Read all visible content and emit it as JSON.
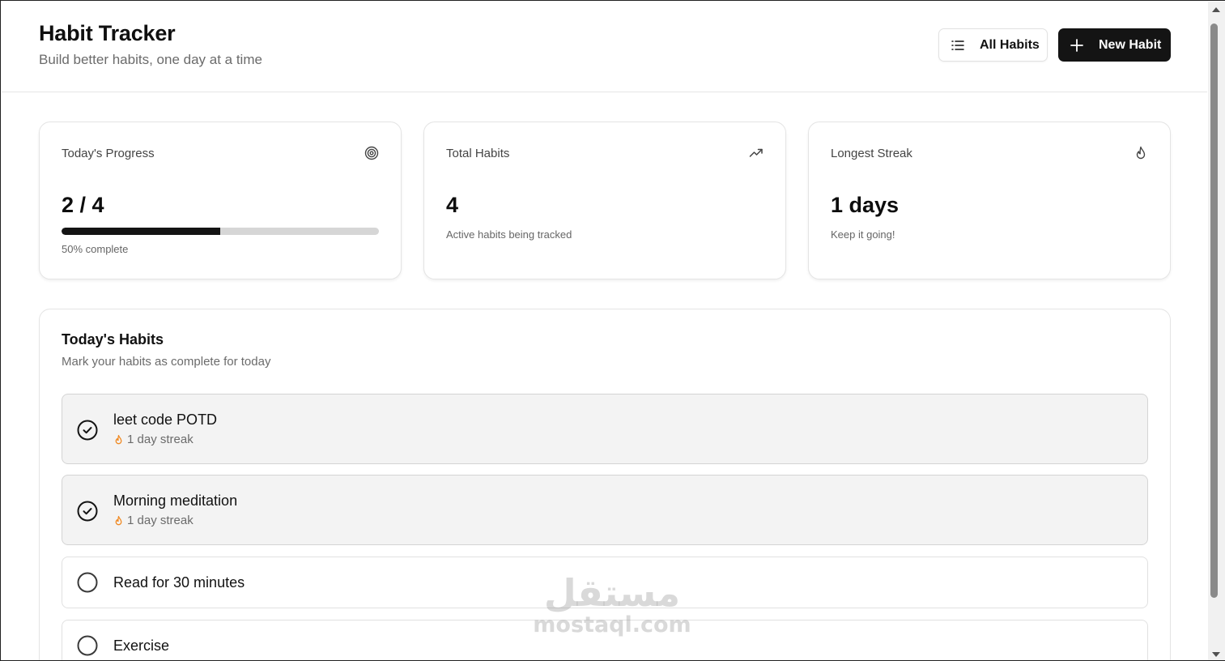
{
  "header": {
    "title": "Habit Tracker",
    "subtitle": "Build better habits, one day at a time",
    "all_habits_label": "All Habits",
    "new_habit_label": "New Habit"
  },
  "stats": {
    "progress": {
      "title": "Today's Progress",
      "value": "2 / 4",
      "fraction": 0.5,
      "note": "50% complete",
      "icon": "target-icon"
    },
    "total": {
      "title": "Total Habits",
      "value": "4",
      "note": "Active habits being tracked",
      "icon": "trending-up-icon"
    },
    "streak": {
      "title": "Longest Streak",
      "value": "1 days",
      "note": "Keep it going!",
      "icon": "flame-icon"
    }
  },
  "habits_panel": {
    "title": "Today's Habits",
    "subtitle": "Mark your habits as complete for today",
    "items": [
      {
        "name": "leet code POTD",
        "completed": true,
        "streak": "1 day streak"
      },
      {
        "name": "Morning meditation",
        "completed": true,
        "streak": "1 day streak"
      },
      {
        "name": "Read for 30 minutes",
        "completed": false,
        "streak": ""
      },
      {
        "name": "Exercise",
        "completed": false,
        "streak": ""
      }
    ]
  },
  "watermark": {
    "arabic": "مستقل",
    "latin": "mostaql.com"
  },
  "colors": {
    "primary": "#141414",
    "muted_text": "#6b6b6b",
    "track": "#d6d6d6",
    "completed_bg": "#f3f3f3",
    "flame": "#f08a24"
  }
}
